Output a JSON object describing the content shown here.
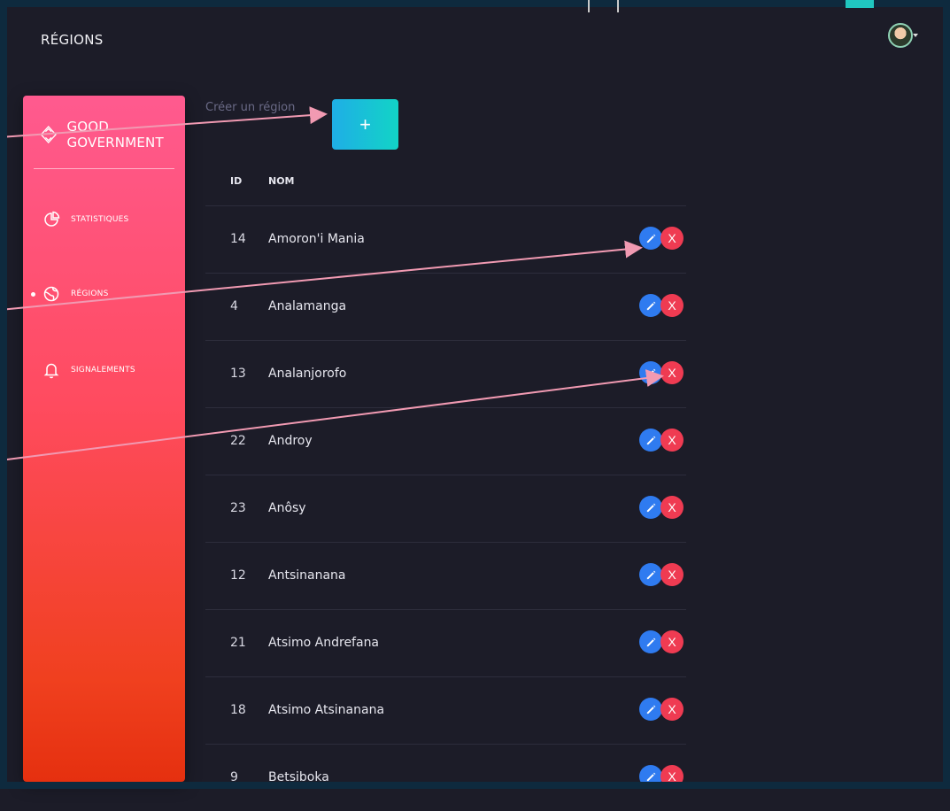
{
  "header": {
    "title": "RÉGIONS",
    "avatar_icon": "user-avatar"
  },
  "sidebar": {
    "brand_name": "GOOD GOVERNMENT",
    "items": [
      {
        "label": "STATISTIQUES",
        "icon": "pie-chart-icon",
        "active": false
      },
      {
        "label": "RÉGIONS",
        "icon": "globe-icon",
        "active": true
      },
      {
        "label": "SIGNALEMENTS",
        "icon": "bell-icon",
        "active": false
      }
    ]
  },
  "main": {
    "create_label": "Créer un région",
    "add_button_label": "+",
    "table": {
      "headers": {
        "id": "ID",
        "nom": "NOM"
      },
      "rows": [
        {
          "id": "14",
          "nom": "Amoron'i Mania"
        },
        {
          "id": "4",
          "nom": "Analamanga"
        },
        {
          "id": "13",
          "nom": "Analanjorofo"
        },
        {
          "id": "22",
          "nom": "Androy"
        },
        {
          "id": "23",
          "nom": "Anôsy"
        },
        {
          "id": "12",
          "nom": "Antsinanana"
        },
        {
          "id": "21",
          "nom": "Atsimo Andrefana"
        },
        {
          "id": "18",
          "nom": "Atsimo Atsinanana"
        },
        {
          "id": "9",
          "nom": "Betsiboka"
        }
      ],
      "delete_label": "X"
    }
  },
  "colors": {
    "background": "#1c1c28",
    "sidebar_top": "#ff5a8f",
    "sidebar_bottom": "#e5300f",
    "add_button": "#12d4c6",
    "edit_button": "#2f7bf0",
    "delete_button": "#ef3b52",
    "annotation_arrow": "#f19ab2"
  }
}
